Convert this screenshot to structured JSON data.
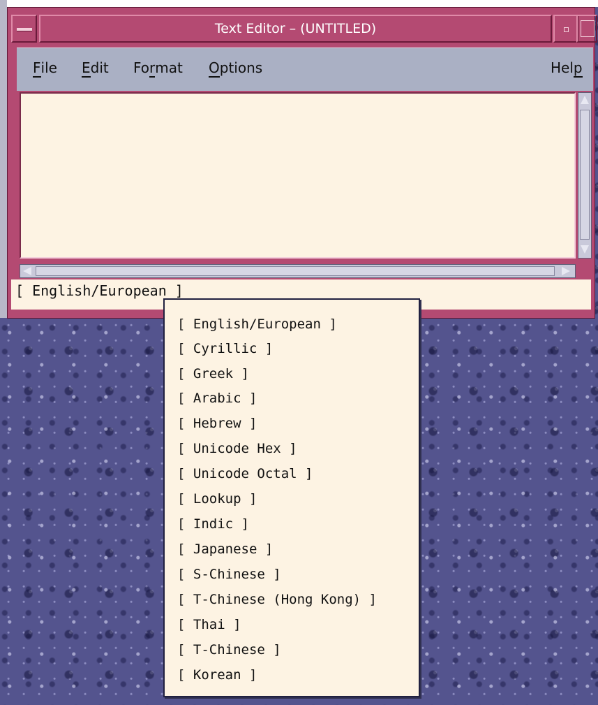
{
  "window": {
    "title": "Text Editor – (UNTITLED)"
  },
  "menubar": {
    "items": [
      {
        "label": "File",
        "mnemonic": "F"
      },
      {
        "label": "Edit",
        "mnemonic": "E"
      },
      {
        "label": "Format",
        "mnemonic": "r"
      },
      {
        "label": "Options",
        "mnemonic": "O"
      },
      {
        "label": "Help",
        "mnemonic": "p"
      }
    ]
  },
  "editor": {
    "content": ""
  },
  "status": {
    "input_method": "[ English/European ]"
  },
  "input_method_menu": {
    "items": [
      "[ English/European ]",
      "[ Cyrillic ]",
      "[ Greek ]",
      "[ Arabic ]",
      "[ Hebrew ]",
      "[ Unicode Hex ]",
      "[ Unicode Octal ]",
      "[ Lookup ]",
      "[ Indic ]",
      "[ Japanese ]",
      "[ S-Chinese ]",
      "[ T-Chinese (Hong Kong) ]",
      "[ Thai ]",
      "[ T-Chinese ]",
      "[ Korean ]"
    ]
  },
  "colors": {
    "window_frame": "#b44a72",
    "menubar": "#aab0c4",
    "text_background": "#fdf3e3",
    "desktop": "#54548e"
  }
}
